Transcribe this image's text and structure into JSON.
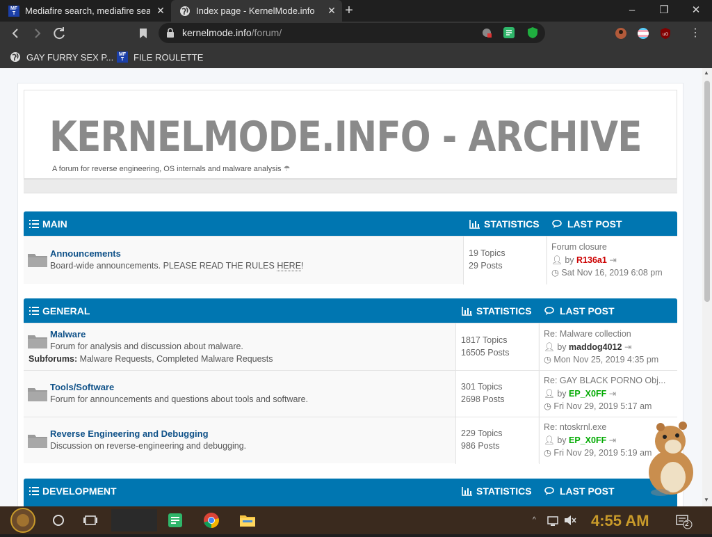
{
  "browser": {
    "tabs": [
      {
        "title": "Mediafire search, mediafire sea",
        "favicon": "MF T",
        "active": false
      },
      {
        "title": "Index page - KernelMode.info",
        "favicon": "globe-icon",
        "active": true
      }
    ],
    "new_tab": "+",
    "window_controls": {
      "minimize": "–",
      "maximize": "❐",
      "close": "✕"
    },
    "url": {
      "host": "kernelmode.info",
      "path": "/forum/"
    },
    "bookmarks": [
      {
        "label": "GAY FURRY SEX P...",
        "icon": "globe-icon"
      },
      {
        "label": "FILE ROULETTE",
        "icon": "MF T"
      }
    ]
  },
  "site": {
    "title": "KERNELMODE.INFO - ARCHIVE",
    "description": "A forum for reverse engineering, OS internals and malware analysis"
  },
  "categories": [
    {
      "name": "MAIN",
      "statistics_label": "STATISTICS",
      "last_post_label": "LAST POST",
      "forums": [
        {
          "title": "Announcements",
          "description_pre": "Board-wide announcements. PLEASE READ THE RULES ",
          "description_link": "HERE",
          "description_post": "!",
          "topics": "19 Topics",
          "posts": "29 Posts",
          "last_post_title": "Forum closure",
          "by": "by",
          "last_post_user": "R136a1",
          "user_color": "red",
          "last_post_date": "Sat Nov 16, 2019 6:08 pm"
        }
      ]
    },
    {
      "name": "GENERAL",
      "statistics_label": "STATISTICS",
      "last_post_label": "LAST POST",
      "forums": [
        {
          "title": "Malware",
          "description": "Forum for analysis and discussion about malware.",
          "subforums_label": "Subforums:",
          "subforums": "Malware Requests, Completed Malware Requests",
          "topics": "1817 Topics",
          "posts": "16505 Posts",
          "last_post_title": "Re: Malware collection",
          "by": "by",
          "last_post_user": "maddog4012",
          "user_color": "dark",
          "last_post_date": "Mon Nov 25, 2019 4:35 pm"
        },
        {
          "title": "Tools/Software",
          "description": "Forum for announcements and questions about tools and software.",
          "topics": "301 Topics",
          "posts": "2698 Posts",
          "last_post_title": "Re: GAY BLACK PORNO Obj...",
          "by": "by",
          "last_post_user": "EP_X0FF",
          "user_color": "green",
          "last_post_date": "Fri Nov 29, 2019 5:17 am"
        },
        {
          "title": "Reverse Engineering and Debugging",
          "description": "Discussion on reverse-engineering and debugging.",
          "topics": "229 Topics",
          "posts": "986 Posts",
          "last_post_title": "Re: ntoskrnl.exe",
          "by": "by",
          "last_post_user": "EP_X0FF",
          "user_color": "green",
          "last_post_date": "Fri Nov 29, 2019 5:19 am"
        }
      ]
    },
    {
      "name": "DEVELOPMENT",
      "statistics_label": "STATISTICS",
      "last_post_label": "LAST POST",
      "forums": []
    }
  ],
  "taskbar": {
    "clock": "4:55 AM",
    "notifications_count": "2"
  },
  "colors": {
    "forum_header": "#0076b1",
    "forum_title": "#105289",
    "user_red": "#cc0000",
    "user_green": "#00aa00"
  }
}
